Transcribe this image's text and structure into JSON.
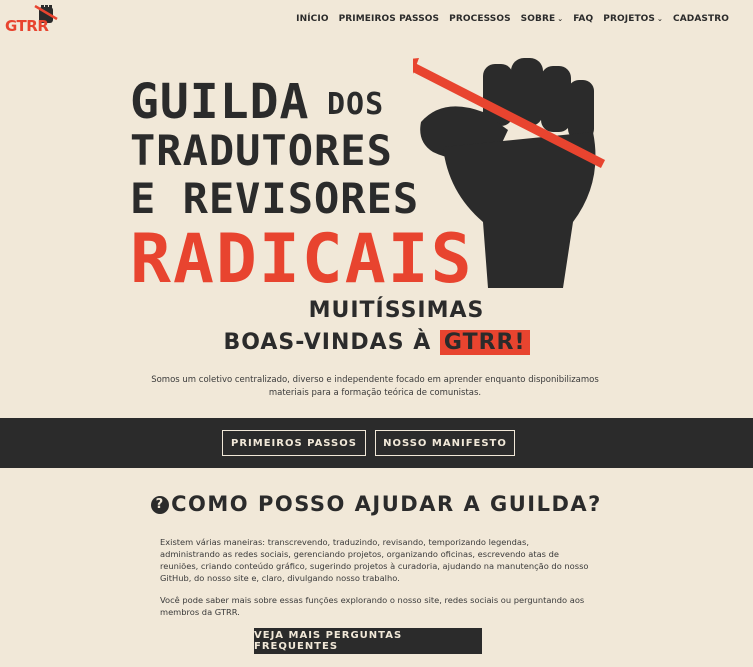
{
  "brand": {
    "logo_text": "GTRR",
    "accent": "#e8442f",
    "dark": "#2b2b2b",
    "background": "#f1e8d8"
  },
  "nav": {
    "items": [
      {
        "label": "INÍCIO"
      },
      {
        "label": "PRIMEIROS PASSOS"
      },
      {
        "label": "PROCESSOS"
      },
      {
        "label": "SOBRE",
        "dropdown": true
      },
      {
        "label": "FAQ"
      },
      {
        "label": "PROJETOS",
        "dropdown": true
      },
      {
        "label": "CADASTRO"
      }
    ]
  },
  "hero": {
    "line1": "GUILDA",
    "line1b": "DOS",
    "line2": "TRADUTORES",
    "line3": "E REVISORES",
    "line4": "RADICAIS",
    "illustration": "raised-fist-with-pen-icon"
  },
  "welcome": {
    "line1": "MUITÍSSIMAS",
    "line2_prefix": "BOAS-VINDAS À",
    "line2_highlight": "GTRR!",
    "intro": "Somos um coletivo centralizado, diverso e independente focado em aprender enquanto disponibilizamos materiais para a formação teórica de comunistas."
  },
  "band": {
    "btn_first_steps": "PRIMEIROS PASSOS",
    "btn_manifesto": "NOSSO MANIFESTO"
  },
  "help": {
    "title": "COMO POSSO AJUDAR A GUILDA?",
    "para1": "Existem várias maneiras: transcrevendo, traduzindo, revisando, temporizando legendas, administrando as redes sociais, gerenciando projetos, organizando oficinas, escrevendo atas de reuniões, criando conteúdo gráfico, sugerindo projetos à curadoria, ajudando na manutenção do nosso GitHub, do nosso site e, claro, divulgando nosso trabalho.",
    "para2": "Você pode saber mais sobre essas funções explorando o nosso site, redes sociais ou perguntando aos membros da GTRR.",
    "btn_faq": "VEJA MAIS PERGUNTAS FREQUENTES"
  }
}
